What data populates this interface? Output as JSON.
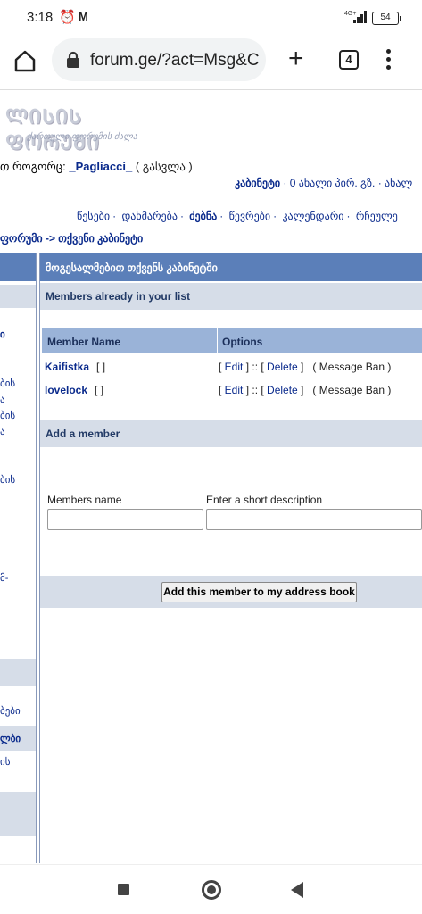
{
  "status": {
    "time": "3:18",
    "network": "4G+",
    "battery": "54"
  },
  "browser": {
    "url": "forum.ge/?act=Msg&C",
    "tab_count": "4"
  },
  "logo": {
    "title": "ᲚᲘᲡᲘᲡ ᲤᲝᲠᲣᲛᲘ",
    "tagline": "ქართული ფორუმის ძალა"
  },
  "user": {
    "logged_in_prefix": "თ როგორც: ",
    "username": "_Pagliacci_",
    "logout": "( გასვლა )"
  },
  "top_links": {
    "cabinet": "კაბინეტი",
    "rest": " · 0 ახალი პირ. გზ. · ახალ"
  },
  "nav": {
    "items": [
      "წესები",
      "დახმარება",
      "ძებნა",
      "წევრები",
      "კალენდარი",
      "რჩეულე"
    ]
  },
  "breadcrumb": "ფორუმი -> თქვენი კაბინეტი",
  "left_fragments": [
    "ბის",
    "ა",
    "ბის",
    "ა",
    "ბის",
    "მ-",
    "ბები",
    "ლბი",
    "ის"
  ],
  "panel": {
    "header": "მოგესალმებით თქვენს კაბინეტში",
    "members_section": "Members already in your list",
    "col_name": "Member Name",
    "col_options": "Options",
    "members": [
      {
        "name": "Kaifistka",
        "brackets": "[ ]",
        "edit": "Edit",
        "delete": "Delete",
        "ban": "( Message Ban )"
      },
      {
        "name": "lovelock",
        "brackets": "[ ]",
        "edit": "Edit",
        "delete": "Delete",
        "ban": "( Message Ban )"
      }
    ],
    "add_section": "Add a member",
    "members_name_label": "Members name",
    "description_label": "Enter a short description",
    "add_button": "Add this member to my address book"
  }
}
